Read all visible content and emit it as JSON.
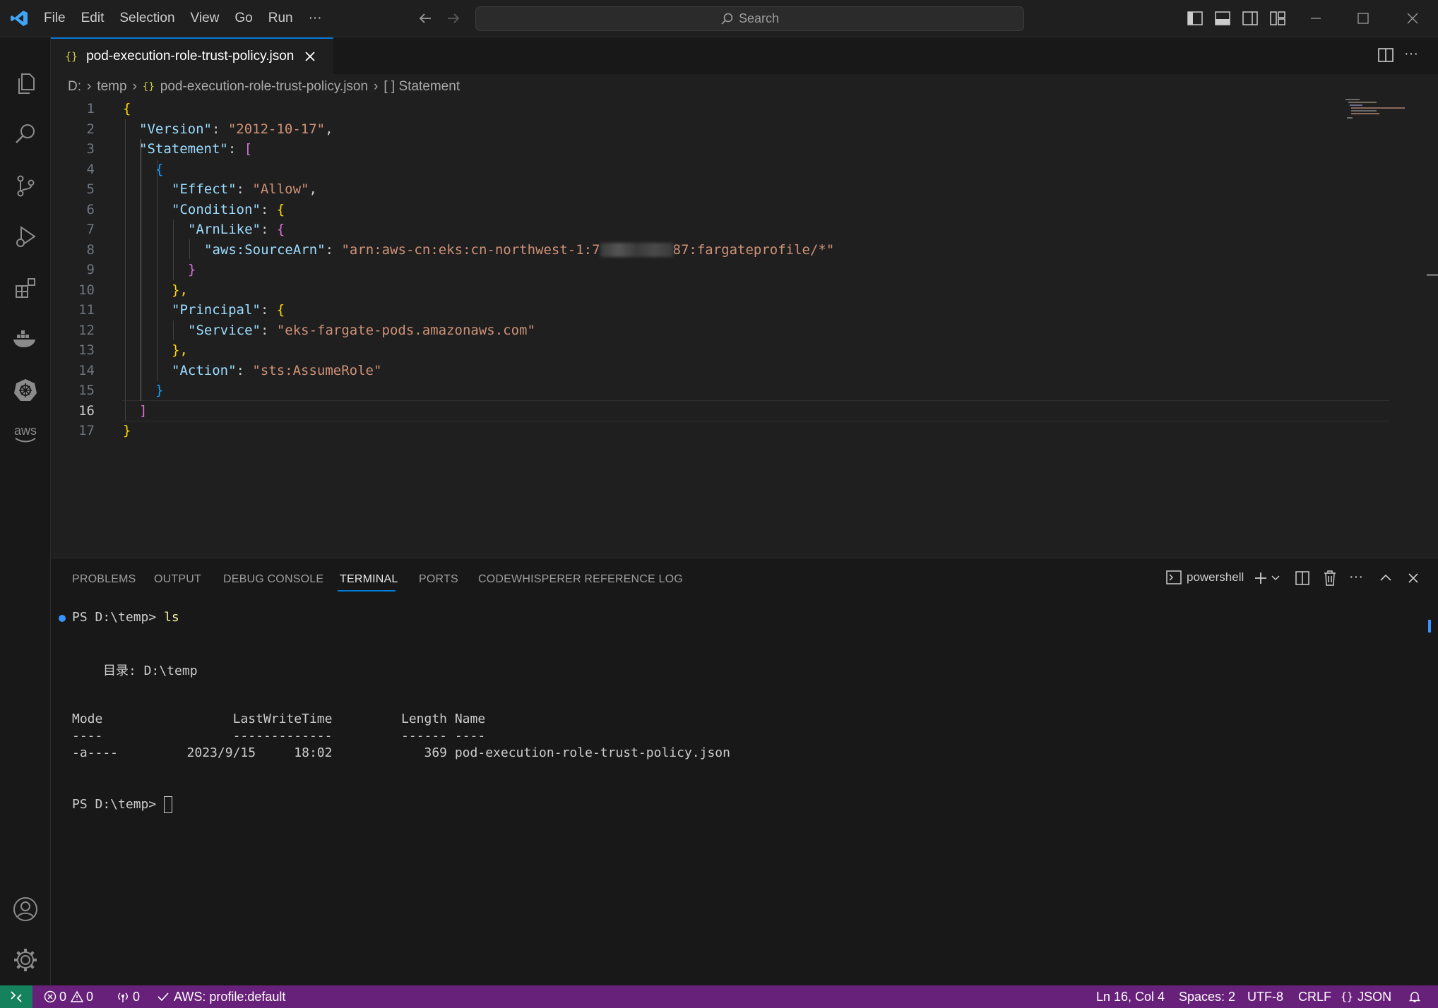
{
  "menu": [
    "File",
    "Edit",
    "Selection",
    "View",
    "Go",
    "Run",
    "···"
  ],
  "search": {
    "label": "Search"
  },
  "tab": {
    "title": "pod-execution-role-trust-policy.json",
    "icon": "{}"
  },
  "breadcrumb": {
    "drive": "D:",
    "folder": "temp",
    "file": "pod-execution-role-trust-policy.json",
    "symbol": "[ ] Statement"
  },
  "editor": {
    "line_numbers": [
      "1",
      "2",
      "3",
      "4",
      "5",
      "6",
      "7",
      "8",
      "9",
      "10",
      "11",
      "12",
      "13",
      "14",
      "15",
      "16",
      "17"
    ],
    "current_line": "16",
    "code": {
      "l1": "{",
      "l2_key": "\"Version\"",
      "l2_val": "\"2012-10-17\"",
      "l3_key": "\"Statement\"",
      "l3_br": "[",
      "l4": "{",
      "l5_key": "\"Effect\"",
      "l5_val": "\"Allow\"",
      "l6_key": "\"Condition\"",
      "l6_br": "{",
      "l7_key": "\"ArnLike\"",
      "l7_br": "{",
      "l8_key": "\"aws:SourceArn\"",
      "l8_val_a": "\"arn:aws-cn:eks:cn-northwest-1:7",
      "l8_val_b": "87:fargateprofile/*\"",
      "l9": "}",
      "l10": "},",
      "l11_key": "\"Principal\"",
      "l11_br": "{",
      "l12_key": "\"Service\"",
      "l12_val": "\"eks-fargate-pods.amazonaws.com\"",
      "l13": "},",
      "l14_key": "\"Action\"",
      "l14_val": "\"sts:AssumeRole\"",
      "l15": "}",
      "l16": "]",
      "l17": "}"
    }
  },
  "panel": {
    "tabs": [
      "PROBLEMS",
      "OUTPUT",
      "DEBUG CONSOLE",
      "TERMINAL",
      "PORTS",
      "CODEWHISPERER REFERENCE LOG"
    ],
    "active_tab": "TERMINAL",
    "shell": "powershell"
  },
  "terminal": {
    "cmd_prompt": "PS D:\\temp>",
    "cmd": "ls",
    "dir_header": "目录: D:\\temp",
    "col_header": "Mode                 LastWriteTime         Length Name",
    "col_rule": "----                 -------------         ------ ----",
    "row": "-a----         2023/9/15     18:02            369 pod-execution-role-trust-policy.json",
    "prompt2": "PS D:\\temp>"
  },
  "status": {
    "errors": "0",
    "warnings": "0",
    "ports": "0",
    "aws": "AWS: profile:default",
    "position": "Ln 16, Col 4",
    "spaces": "Spaces: 2",
    "encoding": "UTF-8",
    "eol": "CRLF",
    "language": "JSON"
  },
  "colors": {
    "accent": "#0078d4",
    "status_bg": "#68217a",
    "bracket1": "#ffd700",
    "bracket2": "#da70d6",
    "bracket3": "#179fff"
  }
}
